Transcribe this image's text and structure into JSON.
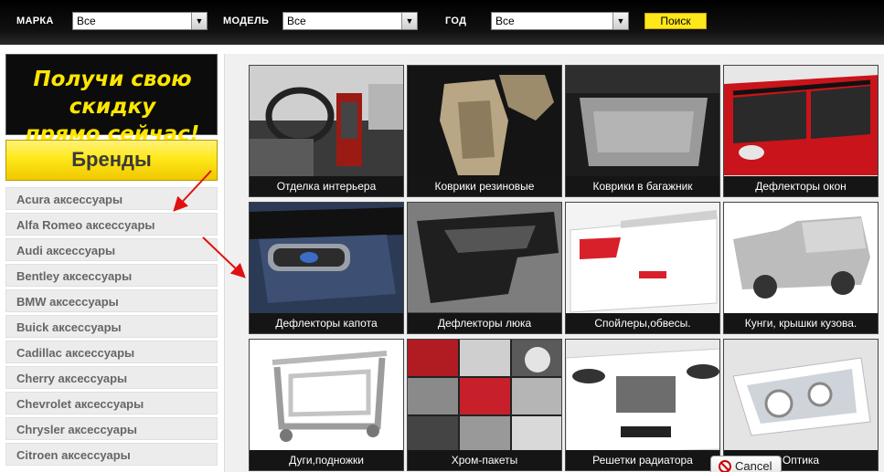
{
  "filter_bar": {
    "make_label": "МАРКА",
    "make_value": "Все",
    "model_label": "МОДЕЛЬ",
    "model_value": "Все",
    "year_label": "ГОД",
    "year_value": "Все",
    "search_button": "Поиск"
  },
  "promo": {
    "line1": "Получи свою скидку",
    "line2": "прямо сейчас!"
  },
  "brands": {
    "title": "Бренды",
    "items": [
      "Acura аксессуары",
      "Alfa Romeo аксессуары",
      "Audi аксессуары",
      "Bentley аксессуары",
      "BMW аксессуары",
      "Buick аксессуары",
      "Cadillac аксессуары",
      "Cherry аксессуары",
      "Chevrolet аксессуары",
      "Chrysler аксессуары",
      "Citroen аксессуары"
    ]
  },
  "categories": [
    "Отделка интерьера",
    "Коврики резиновые",
    "Коврики в багажник",
    "Дефлекторы окон",
    "Дефлекторы капота",
    "Дефлекторы люка",
    "Спойлеры,обвесы.",
    "Кунги, крышки кузова.",
    "Дуги,подножки",
    "Хром-пакеты",
    "Решетки радиатора",
    "Оптика"
  ],
  "popup": {
    "cancel_label": "Cancel"
  },
  "colors": {
    "accent_yellow": "#ffe81a",
    "topbar_black": "#000000",
    "annotation_red": "#e01010"
  }
}
